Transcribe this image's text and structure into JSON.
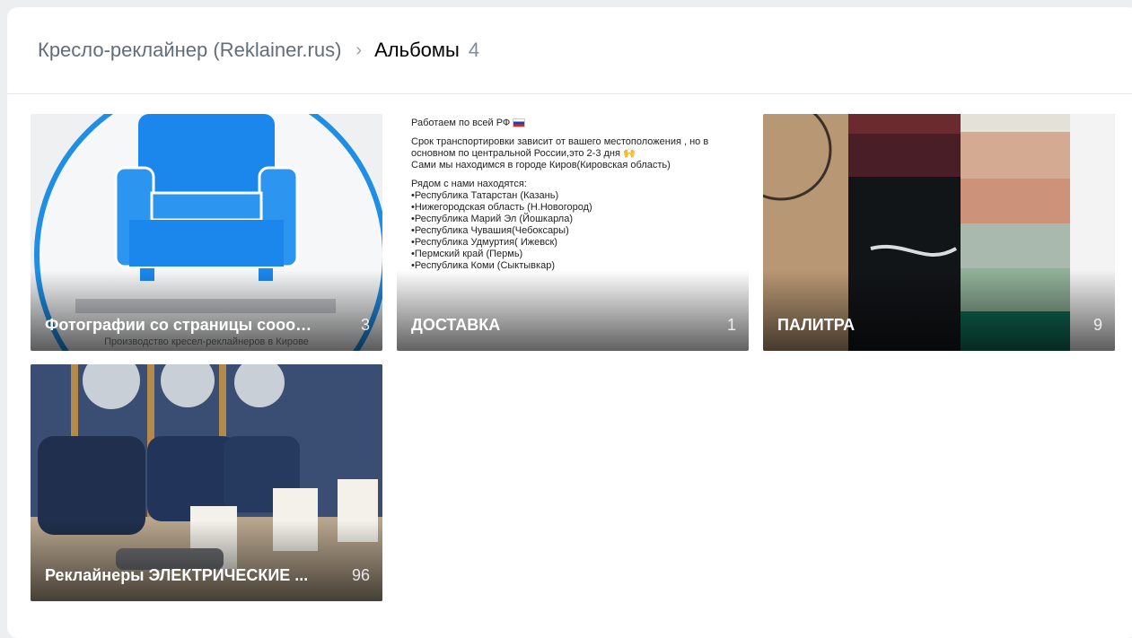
{
  "breadcrumb": {
    "group": "Кресло-реклайнер (Reklainer.rus)",
    "separator": "›",
    "section": "Альбомы",
    "count": "4"
  },
  "albums": [
    {
      "title": "Фотографии со страницы сооощ...",
      "count": "3",
      "subtitle": "Производство кресел-реклайнеров в Кирове"
    },
    {
      "title": "ДОСТАВКА",
      "count": "1",
      "cover_text": {
        "line1": "Работаем по всей РФ",
        "para2": "Срок транспортировки зависит от вашего местоположения , но в основном по центральной России,это 2-3 дня",
        "para3": "Сами мы находимся в городе Киров(Кировская область)",
        "para4": "Рядом с нами находятся:",
        "items": [
          "•Республика Татарстан (Казань)",
          "•Нижегородская область (Н.Новогород)",
          "•Республика Марий Эл (Йошкарла)",
          "•Республика Чувашия(Чебоксары)",
          "•Республика Удмуртия( Ижевск)",
          "•Пермский край (Пермь)",
          "•Республика Коми (Сыктывкар)"
        ]
      }
    },
    {
      "title": "ПАЛИТРА",
      "count": "9"
    },
    {
      "title": "Реклайнеры ЭЛЕКТРИЧЕСКИЕ ...",
      "count": "96"
    }
  ],
  "colors": {
    "accent_blue": "#1f8fe6",
    "chair_blue": "#1b87ec"
  }
}
